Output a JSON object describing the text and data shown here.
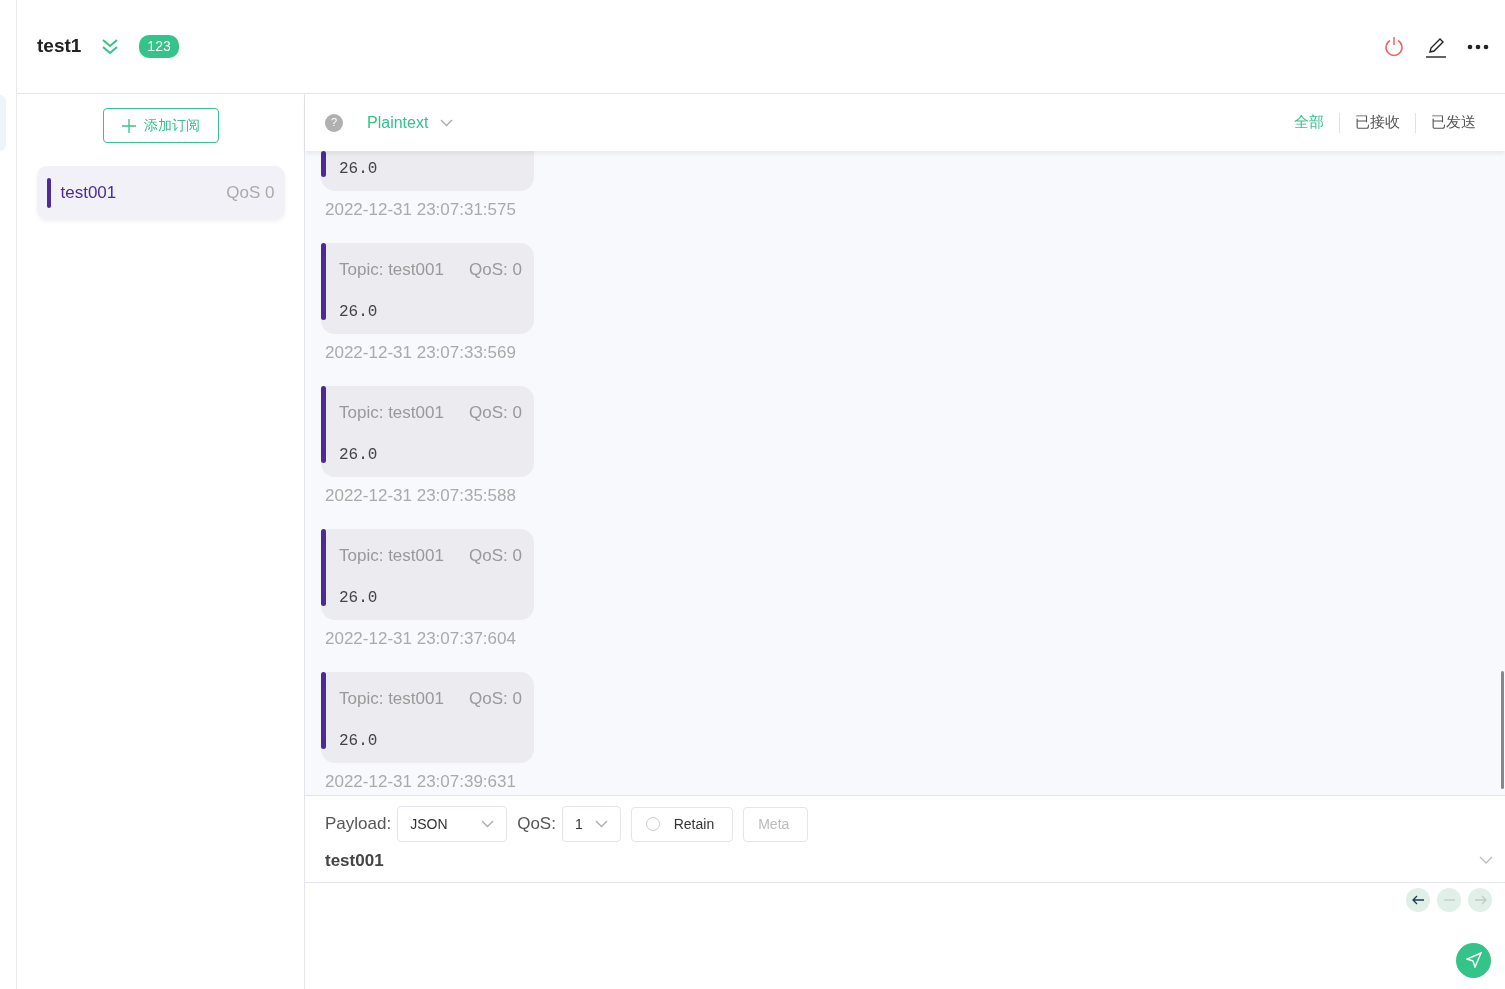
{
  "header": {
    "title": "test1",
    "badge": "123"
  },
  "sidebar": {
    "add_button": "添加订阅",
    "subscriptions": [
      {
        "topic": "test001",
        "qos": "QoS 0",
        "color": "#4d2a97",
        "selected": true
      }
    ]
  },
  "toolbar": {
    "help": "?",
    "format": "Plaintext",
    "filters": [
      {
        "label": "全部",
        "selected": true
      },
      {
        "label": "已接收",
        "selected": false
      },
      {
        "label": "已发送",
        "selected": false
      }
    ]
  },
  "messages": [
    {
      "payload": "26.0",
      "time": "2022-12-31 23:07:31:575"
    },
    {
      "topic": "Topic: test001",
      "qos": "QoS: 0",
      "payload": "26.0",
      "time": "2022-12-31 23:07:33:569"
    },
    {
      "topic": "Topic: test001",
      "qos": "QoS: 0",
      "payload": "26.0",
      "time": "2022-12-31 23:07:35:588"
    },
    {
      "topic": "Topic: test001",
      "qos": "QoS: 0",
      "payload": "26.0",
      "time": "2022-12-31 23:07:37:604"
    },
    {
      "topic": "Topic: test001",
      "qos": "QoS: 0",
      "payload": "26.0",
      "time": "2022-12-31 23:07:39:631"
    }
  ],
  "composer": {
    "payload_label": "Payload:",
    "payload_format": "JSON",
    "qos_label": "QoS:",
    "qos": "1",
    "retain": {
      "label": "Retain",
      "checked": false
    },
    "meta": {
      "label": "Meta",
      "disabled": true
    },
    "topic": "test001",
    "history": [
      {
        "kind": "back",
        "disabled": false
      },
      {
        "kind": "reset",
        "disabled": true
      },
      {
        "kind": "forward",
        "disabled": true
      }
    ]
  }
}
